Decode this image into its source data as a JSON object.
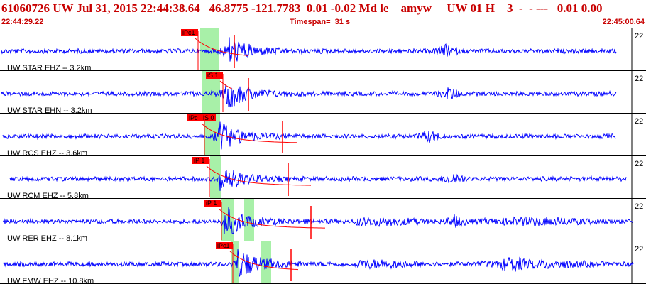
{
  "header": {
    "title": "61060726 UW Jul 31, 2015 22:44:38.64   46.8775 -121.7783  0.01 -0.02 Md le    amyw     UW 01 H    3  -  - ---   0.01 0.00",
    "start_time": "22:44:29.22",
    "timespan": "Timespan=  31 s",
    "end_time": "22:45:00.64"
  },
  "colors": {
    "header_text": "#c80000",
    "trace": "#0000ff",
    "pick": "#ff0000",
    "window": "#a8f0a8",
    "label": "#000000"
  },
  "traces": [
    {
      "label": "UW STAR EHZ -- 3.2km",
      "gain": "22",
      "picks": [
        "iPc1"
      ]
    },
    {
      "label": "UW STAR EHN -- 3.2km",
      "gain": "22",
      "picks": [
        "iS 1"
      ]
    },
    {
      "label": "UW RCS EHZ -- 3.6km",
      "gain": "22",
      "picks": [
        "iPc",
        "iS 0"
      ]
    },
    {
      "label": "UW RCM EHZ -- 5.8km",
      "gain": "22",
      "picks": [
        "iP 1"
      ]
    },
    {
      "label": "UW RER EHZ -- 8.1km",
      "gain": "22",
      "picks": [
        "iP 1"
      ]
    },
    {
      "label": "UW FMW EHZ -- 10.8km",
      "gain": "22",
      "picks": [
        "iPc1"
      ]
    }
  ]
}
